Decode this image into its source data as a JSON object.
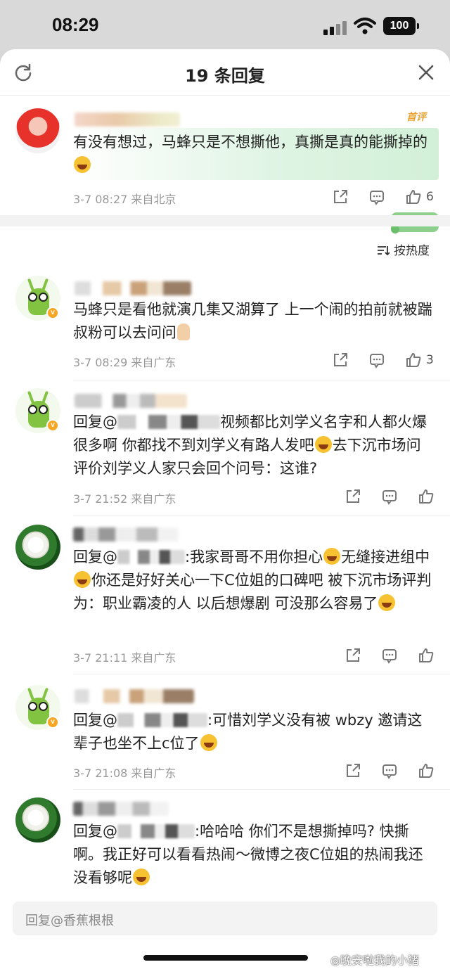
{
  "status_bar": {
    "time": "08:29",
    "battery": "100"
  },
  "header": {
    "title": "19 条回复"
  },
  "root_comment": {
    "badge": "首评",
    "text": "有没有想过，马蜂只是不想撕他，真撕是真的能撕掉的",
    "meta": "3-7 08:27 来自北京",
    "like_count": "6"
  },
  "sort": {
    "label": "按热度"
  },
  "replies": [
    {
      "text": "马蜂只是看他就演几集又湖算了 上一个闹的拍前就被踹叔粉可以去问问",
      "meta": "3-7 08:29 来自广东",
      "like_count": "3"
    },
    {
      "prefix": "回复@",
      "text": "视频都比刘学义名字和人都火爆很多啊 你都找不到刘学义有路人发吧",
      "text2": "去下沉市场问评价刘学义人家只会回个问号：这谁?",
      "meta": "3-7 21:52 来自广东"
    },
    {
      "prefix": "回复@",
      "text": ":我家哥哥不用你担心",
      "text2": "无缝接进组中",
      "text3": "你还是好好关心一下C位姐的口碑吧 被下沉市场评判为：职业霸凌的人 以后想爆剧 可没那么容易了",
      "meta": "3-7 21:11 来自广东"
    },
    {
      "prefix": "回复@",
      "text": ":可惜刘学义没有被 wbzy 邀请这辈子也坐不上c位了",
      "meta": "3-7 21:08 来自广东"
    },
    {
      "prefix": "回复@",
      "text": ":哈哈哈 你们不是想撕掉吗? 快撕啊。我正好可以看看热闹～微博之夜C位姐的热闹我还没看够呢"
    }
  ],
  "reply_bar": {
    "placeholder": "回复@香蕉根根"
  },
  "watermark": "晚安啦我的小猪"
}
